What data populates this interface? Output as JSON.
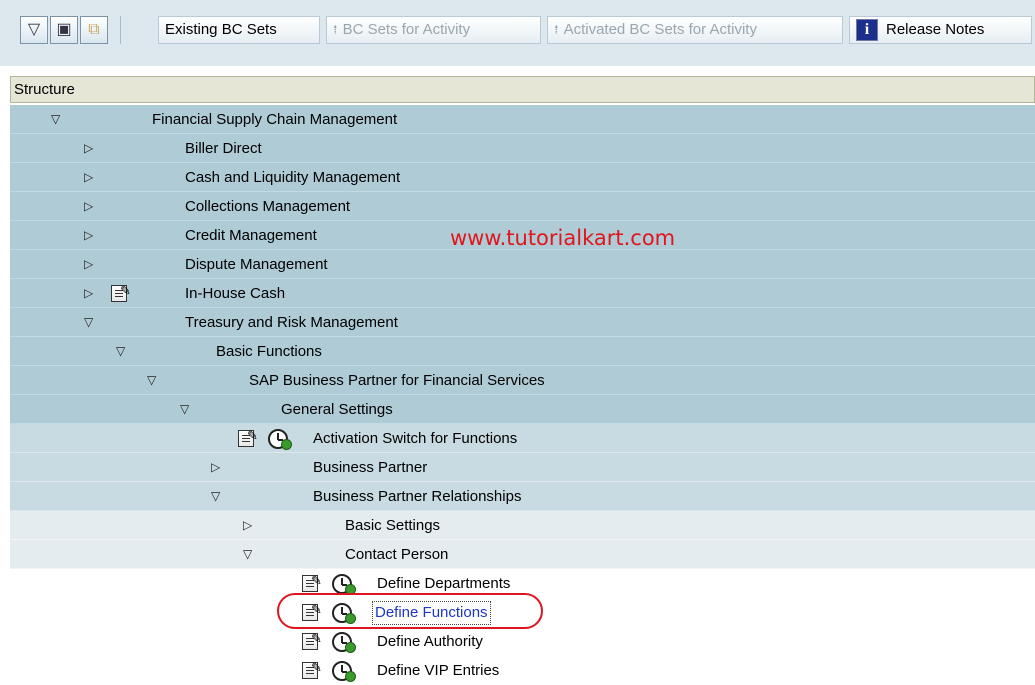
{
  "toolbar": {
    "icon_expand": "expand-subtree-icon",
    "icon_bc": "bc-set-icon",
    "icon_copy": "copy-icon",
    "existing_bc_sets": "Existing BC Sets",
    "bc_sets_for_activity": "BC Sets for Activity",
    "activated_bc_sets": "Activated BC Sets for Activity",
    "release_notes": "Release Notes",
    "info_letter": "i"
  },
  "tree": {
    "header": "Structure",
    "rows": [
      {
        "label": "Financial Supply Chain Management",
        "state": "expanded"
      },
      {
        "label": "Biller Direct",
        "state": "collapsed"
      },
      {
        "label": "Cash and Liquidity Management",
        "state": "collapsed"
      },
      {
        "label": "Collections Management",
        "state": "collapsed"
      },
      {
        "label": "Credit Management",
        "state": "collapsed"
      },
      {
        "label": "Dispute Management",
        "state": "collapsed"
      },
      {
        "label": "In-House Cash",
        "state": "collapsed"
      },
      {
        "label": "Treasury and Risk Management",
        "state": "expanded"
      },
      {
        "label": "Basic Functions",
        "state": "expanded"
      },
      {
        "label": "SAP Business Partner for Financial Services",
        "state": "expanded"
      },
      {
        "label": "General Settings",
        "state": "expanded"
      },
      {
        "label": "Activation Switch for Functions",
        "state": "activity"
      },
      {
        "label": "Business Partner",
        "state": "collapsed"
      },
      {
        "label": "Business Partner Relationships",
        "state": "expanded"
      },
      {
        "label": "Basic Settings",
        "state": "collapsed"
      },
      {
        "label": "Contact Person",
        "state": "expanded"
      },
      {
        "label": "Define Departments",
        "state": "activity"
      },
      {
        "label": "Define Functions",
        "state": "activity-selected"
      },
      {
        "label": "Define Authority",
        "state": "activity"
      },
      {
        "label": "Define VIP Entries",
        "state": "activity"
      }
    ]
  },
  "watermark": "www.tutorialkart.com",
  "colors": {
    "toolbar_bg": "#dde8ee",
    "row_level_1": "#afcbd6",
    "row_level_2": "#c9dbe2",
    "row_level_3": "#e5ecf0",
    "watermark": "#e2141c",
    "highlight": "#e0141e",
    "link": "#1c36c9"
  }
}
